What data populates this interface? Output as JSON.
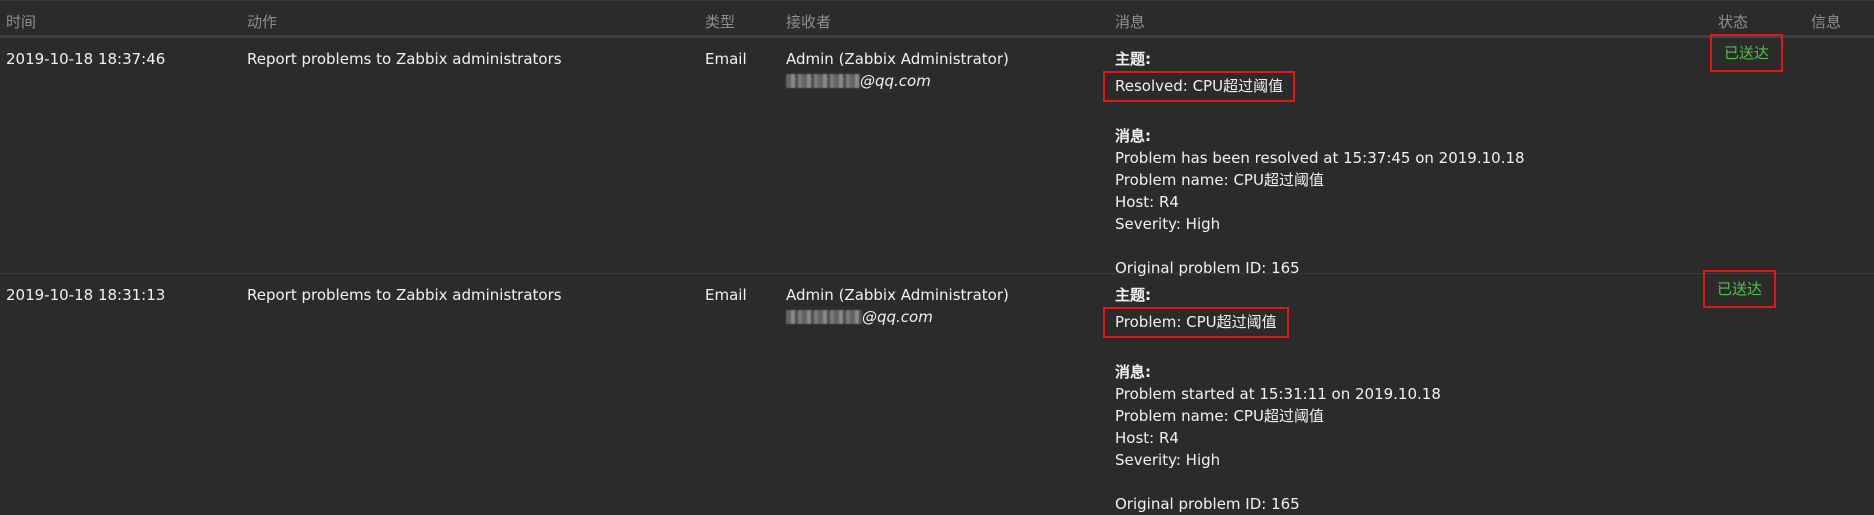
{
  "headers": {
    "time": "时间",
    "action": "动作",
    "type": "类型",
    "recipient": "接收者",
    "message": "消息",
    "status": "状态",
    "info": "信息"
  },
  "rows": [
    {
      "time": "2019-10-18 18:37:46",
      "action": "Report problems to Zabbix administrators",
      "type": "Email",
      "recipient_name": "Admin (Zabbix Administrator)",
      "recipient_email_suffix": "@qq.com",
      "subject_label": "主题:",
      "subject": "Resolved: CPU超过阈值",
      "message_label": "消息:",
      "message_lines": [
        "Problem has been resolved at 15:37:45 on 2019.10.18",
        "Problem name: CPU超过阈值",
        "Host: R4",
        "Severity: High",
        "",
        "Original problem ID: 165"
      ],
      "status": "已送达"
    },
    {
      "time": "2019-10-18 18:31:13",
      "action": "Report problems to Zabbix administrators",
      "type": "Email",
      "recipient_name": "Admin (Zabbix Administrator)",
      "recipient_email_suffix": "@qq.com",
      "subject_label": "主题:",
      "subject": "Problem: CPU超过阈值",
      "message_label": "消息:",
      "message_lines": [
        "Problem started at 15:31:11 on 2019.10.18",
        "Problem name: CPU超过阈值",
        "Host: R4",
        "Severity: High",
        "",
        "Original problem ID: 165"
      ],
      "status": "已送达"
    }
  ],
  "colors": {
    "background": "#2b2b2b",
    "header_text": "#8f8f8f",
    "status_text": "#53c14b",
    "highlight_box": "#e01818"
  }
}
